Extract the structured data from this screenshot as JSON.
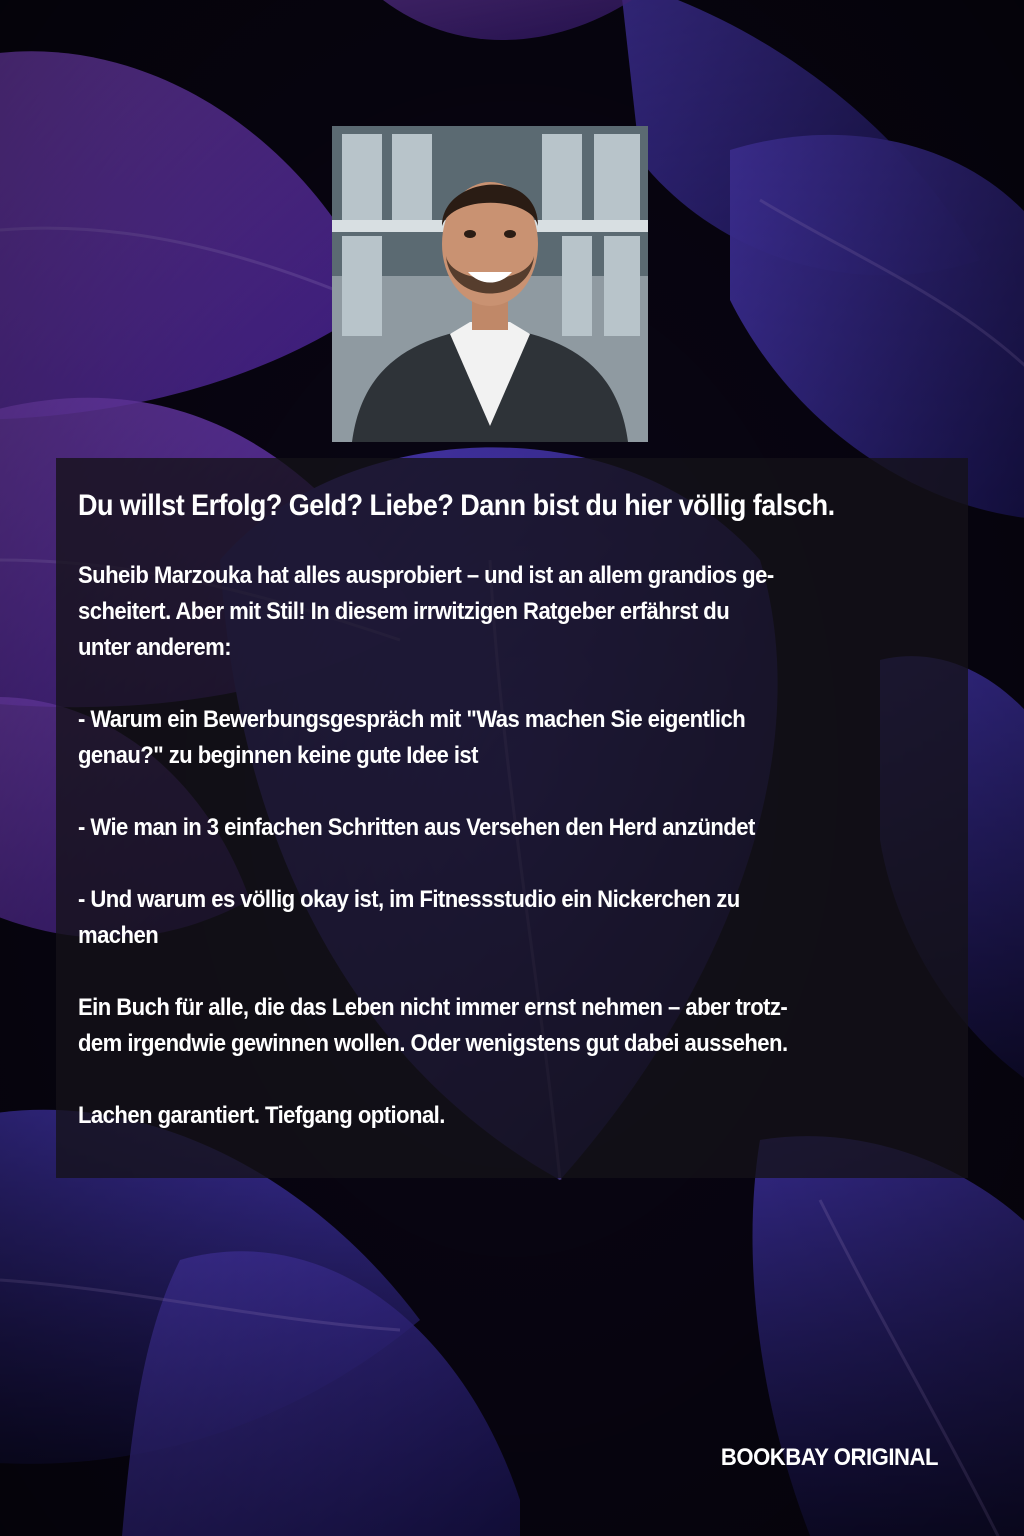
{
  "colors": {
    "background_dark": "#0a0616",
    "leaf_violet": "#7a3fe0",
    "leaf_indigo": "#3a2fb8",
    "text": "#ffffff",
    "panel": "#141218"
  },
  "headline": "Du willst Erfolg? Geld? Liebe? Dann bist du hier völlig falsch.",
  "paragraphs": [
    "Suheib Marzouka hat alles ausprobiert – und ist an allem grandios ge-\nscheitert. Aber mit Stil! In diesem irrwitzigen Ratgeber erfährst du\nunter anderem:",
    "- Warum ein Bewerbungsgespräch mit \"Was machen Sie eigentlich\ngenau?\" zu beginnen keine gute Idee ist",
    "- Wie man in 3 einfachen Schritten aus Versehen den Herd anzündet",
    "- Und warum es völlig okay ist, im Fitnessstudio ein Nickerchen zu\nmachen",
    "Ein Buch für alle, die das Leben nicht immer ernst nehmen – aber trotz-\ndem irgendwie gewinnen wollen. Oder wenigstens gut dabei aussehen.",
    "Lachen garantiert. Tiefgang optional."
  ],
  "brand": "BOOKBAY ORIGINAL"
}
